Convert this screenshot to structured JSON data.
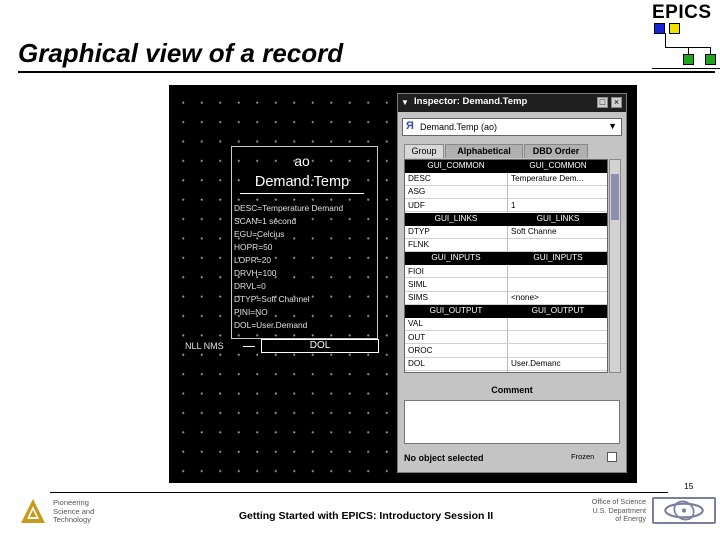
{
  "slide": {
    "title": "Graphical view of a record",
    "brand": "EPICS",
    "page_number": "15",
    "footer_center": "Getting Started with EPICS: Introductory Session II",
    "footer_left": [
      "Pioneering",
      "Science and",
      "Technology"
    ],
    "footer_right": [
      "Office of Science",
      "U.S. Department",
      "of Energy"
    ]
  },
  "colors": {
    "epics_blue": "#1528d6",
    "epics_yellow": "#f2e200",
    "epics_green": "#1ea51e",
    "argonne_gold": "#c89a1a"
  },
  "record": {
    "type": "ao",
    "name": "Demand.Temp",
    "fields": [
      "DESC=Temperature Demand",
      "SCAN=1 second",
      "EGU=Celcius",
      "HOPR=50",
      "LOPR=20",
      "DRVH=100",
      "DRVL=0",
      "DTYP=Soft Channel",
      "PINI=NO",
      "DOL=User.Demand"
    ],
    "link_label": "NLL NMS",
    "link_target": "DOL"
  },
  "inspector": {
    "menu_icon": "chevron-down-icon",
    "title": "Inspector: Demand.Temp",
    "selected_record": "Demand.Temp (ao)",
    "tabs": [
      "Group",
      "Alphabetical",
      "DBD Order"
    ],
    "rows": [
      {
        "name": "GUI_COMMON",
        "value": "GUI_COMMON",
        "header": true
      },
      {
        "name": "DESC",
        "value": "Temperature Dem...",
        "header": false
      },
      {
        "name": "ASG",
        "value": "",
        "header": false
      },
      {
        "name": "UDF",
        "value": "1",
        "header": false
      },
      {
        "name": "GUI_LINKS",
        "value": "GUI_LINKS",
        "header": true
      },
      {
        "name": "DTYP",
        "value": "Soft Channe",
        "header": false
      },
      {
        "name": "FLNK",
        "value": "",
        "header": false
      },
      {
        "name": "GUI_INPUTS",
        "value": "GUI_INPUTS",
        "header": true
      },
      {
        "name": "FIOI",
        "value": "",
        "header": false
      },
      {
        "name": "SIML",
        "value": "",
        "header": false
      },
      {
        "name": "SIMS",
        "value": "<none>",
        "header": false
      },
      {
        "name": "GUI_OUTPUT",
        "value": "GUI_OUTPUT",
        "header": true
      },
      {
        "name": "VAL",
        "value": "",
        "header": false
      },
      {
        "name": "OUT",
        "value": "",
        "header": false
      },
      {
        "name": "OROC",
        "value": "",
        "header": false
      },
      {
        "name": "DOL",
        "value": "User.Demanc",
        "header": false
      }
    ],
    "comment_label": "Comment",
    "status": "No object selected",
    "frozen_label": "Frozen"
  }
}
